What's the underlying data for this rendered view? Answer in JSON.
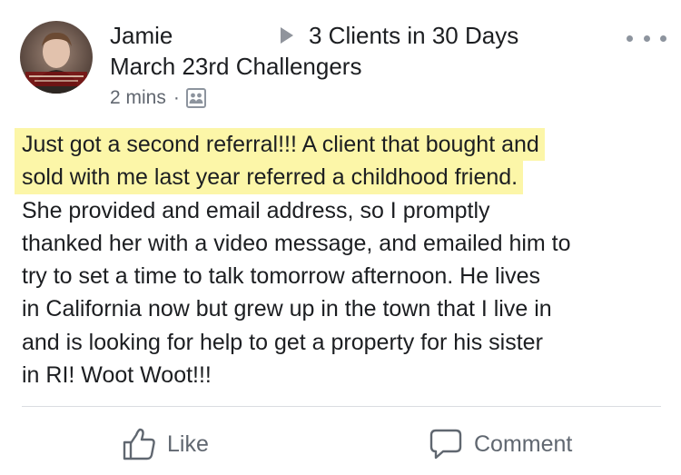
{
  "post": {
    "author": "Jamie",
    "group_name_part1": "3 Clients in 30 Days",
    "group_name_part2": "March 23rd Challengers",
    "timestamp": "2 mins",
    "separator": "·",
    "audience_icon": "group-audience-icon",
    "more_icon": "more-options-icon",
    "avatar_icon": "profile-photo",
    "highlight_color": "#fcf6a8",
    "body_lines": {
      "l1": "Just got a second referral!!!  A client that bought and",
      "l2": "sold with me last year referred a childhood friend.",
      "l3": "She provided and email address, so I promptly",
      "l4": "thanked her with a video message, and emailed him to",
      "l5": "try to set a time to talk tomorrow afternoon. He lives",
      "l6": "in California now but grew up in the town that I live in",
      "l7": "and is looking for help to get a property for his sister",
      "l8": "in RI! Woot Woot!!!"
    }
  },
  "actions": {
    "like_label": "Like",
    "like_icon": "thumbs-up-icon",
    "comment_label": "Comment",
    "comment_icon": "comment-bubble-icon"
  }
}
